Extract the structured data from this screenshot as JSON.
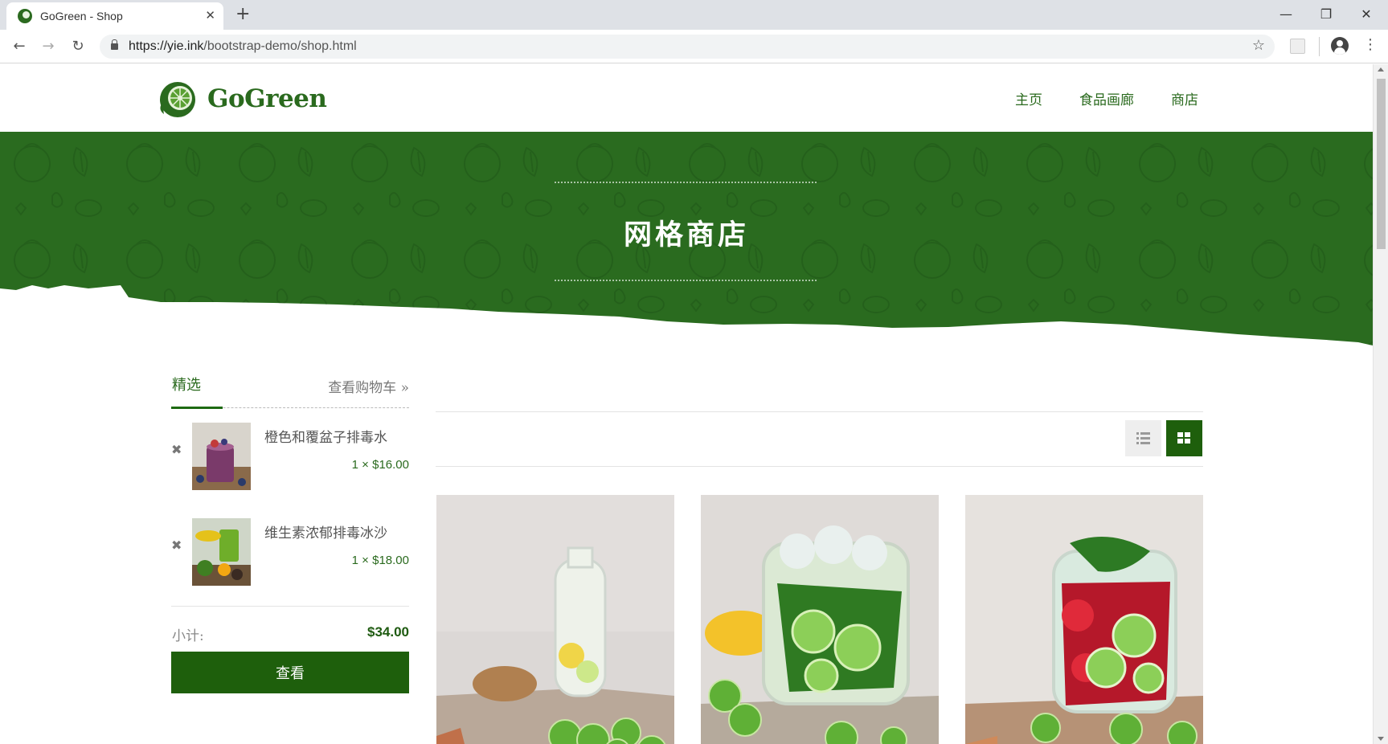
{
  "browser": {
    "tab_title": "GoGreen - Shop",
    "tab_close_icon": "close-icon",
    "new_tab_icon": "plus-icon",
    "url_host": "https://yie.ink",
    "url_path": "/bootstrap-demo/shop.html",
    "window_controls": [
      "minimize-icon",
      "restore-icon",
      "close-icon"
    ]
  },
  "site": {
    "logo_text": "GoGreen",
    "nav": [
      "主页",
      "食品画廊",
      "商店"
    ],
    "brand_color": "#1e5f0c",
    "hero_color": "#2a6b1f"
  },
  "hero": {
    "title": "网格商店"
  },
  "cart": {
    "tab_featured": "精选",
    "view_cart": "查看购物车",
    "view_cart_icon": "double-chevron-right-icon",
    "items": [
      {
        "name": "橙色和覆盆子排毒水",
        "price": "1 × $16.00"
      },
      {
        "name": "维生素浓郁排毒冰沙",
        "price": "1 × $18.00"
      }
    ],
    "subtotal_label": "小计:",
    "subtotal_value": "$34.00",
    "checkout_label": "查看"
  },
  "products": {
    "view_modes": [
      "list-view-icon",
      "grid-view-icon"
    ],
    "active_view": "grid"
  }
}
